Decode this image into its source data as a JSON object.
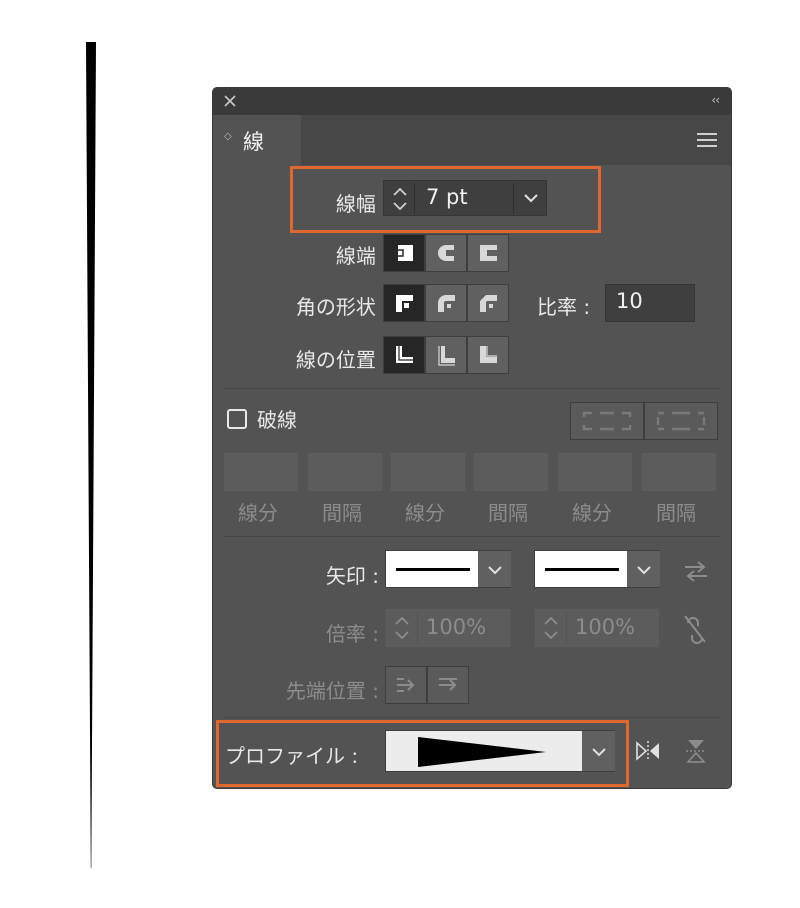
{
  "panel": {
    "tab_label": "線",
    "icons": {
      "close": "close-icon",
      "collapse": "double-chevron-left-icon",
      "menu": "hamburger-menu-icon"
    }
  },
  "stroke": {
    "weight_label": "線幅 :",
    "weight_value": "7 pt",
    "cap_label": "線端 :",
    "corner_label": "角の形状 :",
    "limit_label": "比率 :",
    "limit_value": "10",
    "align_label": "線の位置 :"
  },
  "dashed": {
    "label": "破線",
    "checked": false,
    "field_labels": [
      "線分",
      "間隔",
      "線分",
      "間隔",
      "線分",
      "間隔"
    ]
  },
  "arrows": {
    "label": "矢印 :",
    "scale_label": "倍率 :",
    "scale_start": "100%",
    "scale_end": "100%",
    "align_label": "先端位置 :"
  },
  "profile": {
    "label": "プロファイル :"
  },
  "colors": {
    "highlight": "#e0672e",
    "panel": "#535353",
    "titlebar": "#3a3a3a"
  }
}
